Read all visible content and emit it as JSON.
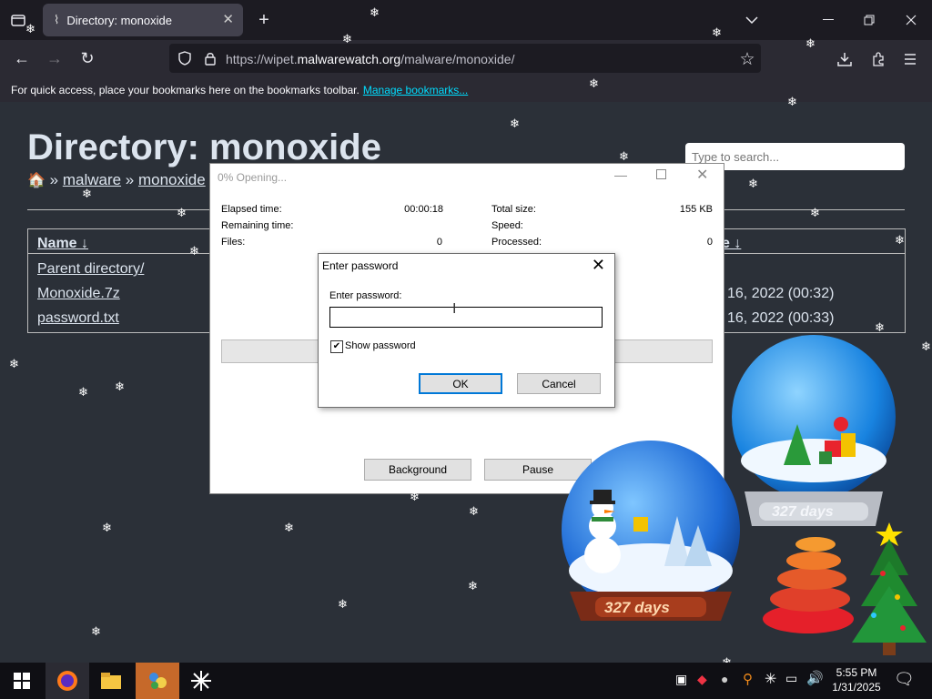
{
  "browser": {
    "tab_title": "Directory: monoxide",
    "url_prefix": "https://wipet.",
    "url_domain": "malwarewatch.org",
    "url_path": "/malware/monoxide/",
    "bookmarks_text": "For quick access, place your bookmarks here on the bookmarks toolbar.",
    "bookmarks_link": "Manage bookmarks..."
  },
  "page": {
    "title": "Directory: monoxide",
    "breadcrumb": [
      "malware",
      "monoxide"
    ],
    "search_placeholder": "Type to search...",
    "table_header_name": "Name ↓",
    "table_header_date": "e ↓",
    "files": [
      {
        "name": "Parent directory/",
        "date": ""
      },
      {
        "name": "Monoxide.7z",
        "date": "16, 2022 (00:32)"
      },
      {
        "name": "password.txt",
        "date": "16, 2022 (00:33)"
      }
    ]
  },
  "opening_dialog": {
    "title": "0% Opening...",
    "elapsed_label": "Elapsed time:",
    "elapsed_value": "00:00:18",
    "remaining_label": "Remaining time:",
    "files_label": "Files:",
    "files_value": "0",
    "total_label": "Total size:",
    "total_value": "155 KB",
    "speed_label": "Speed:",
    "processed_label": "Processed:",
    "processed_value": "0",
    "progress": 0,
    "background_btn": "Background",
    "pause_btn": "Pause"
  },
  "password_dialog": {
    "title": "Enter password",
    "label": "Enter password:",
    "value": "",
    "show_password_label": "Show password",
    "show_password_checked": true,
    "ok_btn": "OK",
    "cancel_btn": "Cancel"
  },
  "desktop": {
    "globe_text": "327 days"
  },
  "taskbar": {
    "time": "5:55 PM",
    "date": "1/31/2025"
  }
}
